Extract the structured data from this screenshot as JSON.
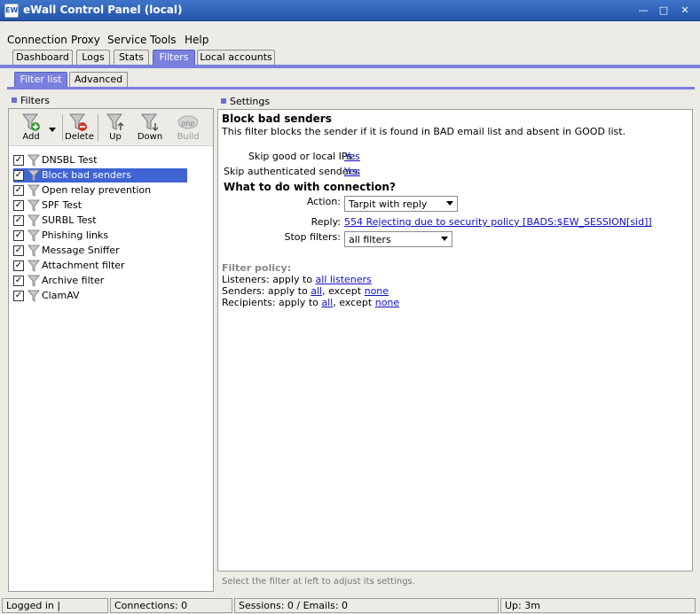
{
  "window": {
    "title": "eWall Control Panel (local)",
    "icon_text": "EW",
    "controls": [
      "—",
      "□",
      "✕"
    ]
  },
  "menu": [
    "Connection",
    "Proxy",
    "Service",
    "Tools",
    "Help"
  ],
  "main_tabs": [
    "Dashboard",
    "Logs",
    "Stats",
    "Filters",
    "Local accounts"
  ],
  "active_main_tab": "Filters",
  "sub_tabs": [
    "Filter list",
    "Advanced"
  ],
  "active_sub_tab": "Filter list",
  "filters_panel": {
    "header": "Filters",
    "toolbar": {
      "add": "Add",
      "delete": "Delete",
      "up": "Up",
      "down": "Down",
      "build": "Build",
      "build_icon_text": "php"
    },
    "items": [
      {
        "label": "DNSBL Test",
        "checked": true
      },
      {
        "label": "Block bad senders",
        "checked": true,
        "selected": true
      },
      {
        "label": "Open relay prevention",
        "checked": true
      },
      {
        "label": "SPF Test",
        "checked": true
      },
      {
        "label": "SURBL Test",
        "checked": true
      },
      {
        "label": "Phishing links",
        "checked": true
      },
      {
        "label": "Message Sniffer",
        "checked": true
      },
      {
        "label": "Attachment filter",
        "checked": true
      },
      {
        "label": "Archive filter",
        "checked": true
      },
      {
        "label": "ClamAV",
        "checked": true
      }
    ]
  },
  "settings_panel": {
    "header": "Settings",
    "filter_title": "Block bad senders",
    "filter_description": "This filter blocks the sender if it is found in BAD email list and absent in GOOD list.",
    "skip_local_label": "Skip good or local IPs:",
    "skip_local_value": "Yes",
    "skip_auth_label": "Skip authenticated senders:",
    "skip_auth_value": "Yes",
    "connection_heading": "What to do with connection?",
    "action_label": "Action:",
    "action_value": "Tarpit with reply",
    "reply_label": "Reply:",
    "reply_value": "554 Rejecting due to security policy [BADS:$EW_SESSION[sid]]",
    "stop_filters_label": "Stop filters:",
    "stop_filters_value": "all filters",
    "policy_heading": "Filter policy:",
    "listeners_prefix": "Listeners: apply to",
    "listeners_value": "all listeners",
    "senders_prefix": "Senders: apply to",
    "senders_value": "all",
    "senders_except": ", except",
    "senders_except_value": "none",
    "recipients_prefix": "Recipients: apply to",
    "recipients_value": "all",
    "recipients_except": ", except",
    "recipients_except_value": "none",
    "hint": "Select the filter at left to adjust its settings."
  },
  "status_bar": {
    "login": "Logged in |",
    "connections": "Connections: 0",
    "sessions": "Sessions: 0 / Emails: 0",
    "uptime": "Up: 3m"
  },
  "colors": {
    "accent": "#7a80dd",
    "titlebar": "#2f63bd",
    "link": "#1010c0",
    "selection": "#3f64d4"
  }
}
